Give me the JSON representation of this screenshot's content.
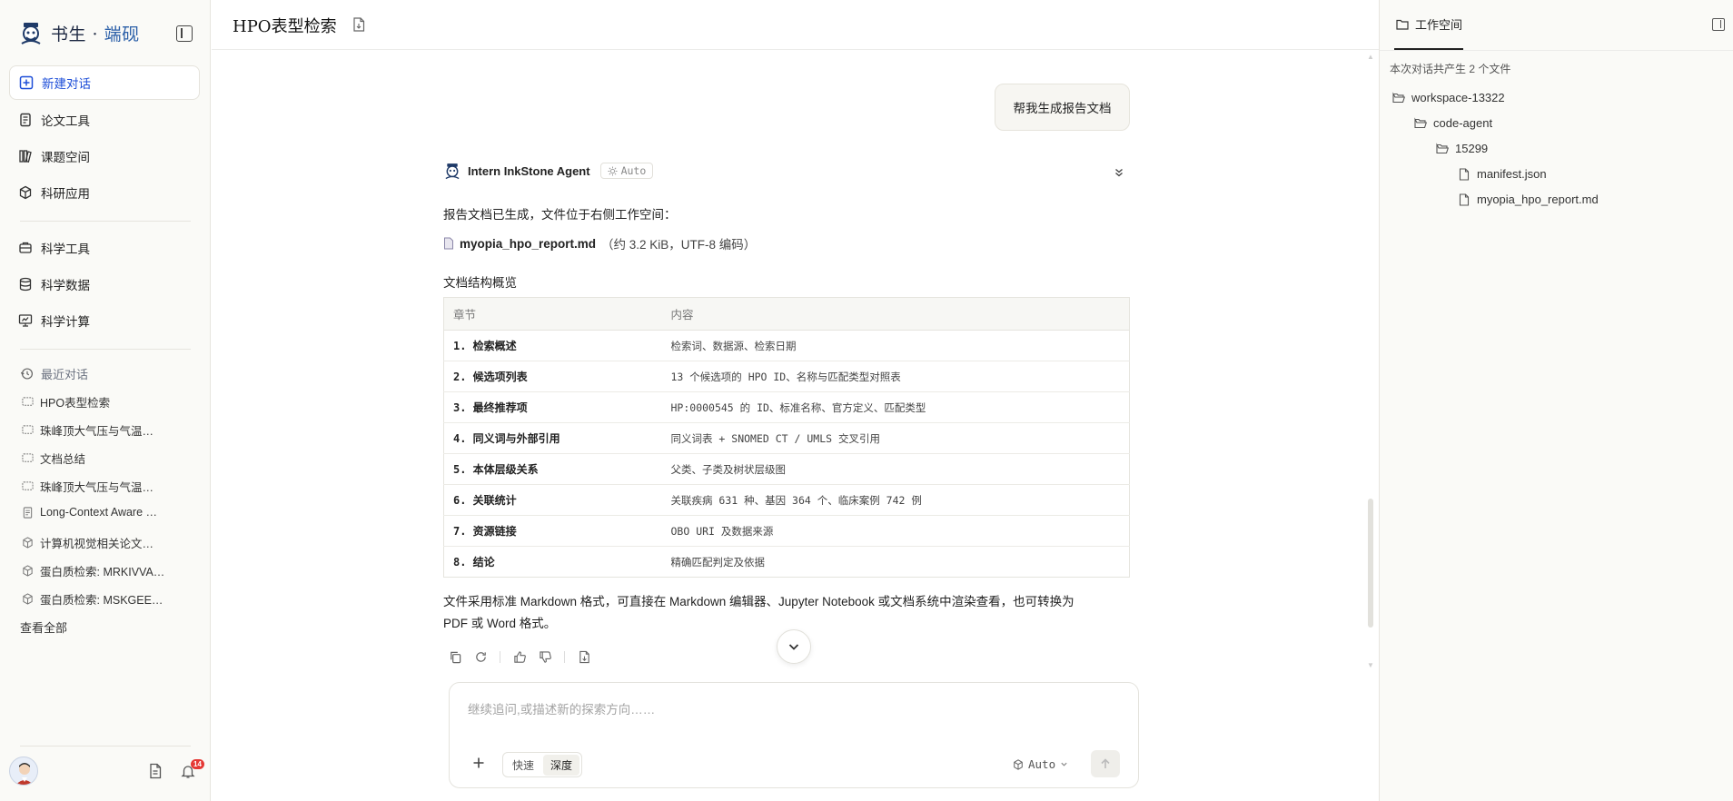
{
  "brand": {
    "name_main": "书生",
    "name_sep": " · ",
    "name_accent": "端砚"
  },
  "sidebar": {
    "new_chat": "新建对话",
    "items": [
      {
        "label": "论文工具",
        "icon": "document-icon"
      },
      {
        "label": "课题空间",
        "icon": "library-icon"
      },
      {
        "label": "科研应用",
        "icon": "cube-icon"
      },
      {
        "label": "科学工具",
        "icon": "toolbox-icon"
      },
      {
        "label": "科学数据",
        "icon": "database-icon"
      },
      {
        "label": "科学计算",
        "icon": "monitor-icon"
      }
    ],
    "recent_title": "最近对话",
    "recent": [
      {
        "label": "HPO表型检索",
        "icon": "chat-icon"
      },
      {
        "label": "珠峰顶大气压与气温…",
        "icon": "chat-icon"
      },
      {
        "label": "文档总结",
        "icon": "chat-icon"
      },
      {
        "label": "珠峰顶大气压与气温…",
        "icon": "chat-icon"
      },
      {
        "label": "Long-Context Aware …",
        "icon": "document-icon"
      },
      {
        "label": "计算机视觉相关论文…",
        "icon": "cube-icon"
      },
      {
        "label": "蛋白质检索: MRKIVVA…",
        "icon": "cube-icon"
      },
      {
        "label": "蛋白质检索: MSKGEE…",
        "icon": "cube-icon"
      }
    ],
    "view_all": "查看全部",
    "notification_count": "14"
  },
  "header": {
    "title": "HPO表型检索"
  },
  "chat": {
    "user_message": "帮我生成报告文档",
    "agent_name": "Intern InkStone Agent",
    "agent_mode": "Auto",
    "intro": "报告文档已生成，文件位于右侧工作空间：",
    "file_name": "myopia_hpo_report.md",
    "file_meta": "（约 3.2 KiB，UTF-8 编码）",
    "structure_title": "文档结构概览",
    "table": {
      "headers": [
        "章节",
        "内容"
      ],
      "rows": [
        [
          "1. 检索概述",
          "检索词、数据源、检索日期"
        ],
        [
          "2. 候选项列表",
          "13 个候选项的 HPO ID、名称与匹配类型对照表"
        ],
        [
          "3. 最终推荐项",
          "HP:0000545 的 ID、标准名称、官方定义、匹配类型"
        ],
        [
          "4. 同义词与外部引用",
          "同义词表 + SNOMED CT / UMLS 交叉引用"
        ],
        [
          "5. 本体层级关系",
          "父类、子类及树状层级图"
        ],
        [
          "6. 关联统计",
          "关联疾病 631 种、基因 364 个、临床案例 742 例"
        ],
        [
          "7. 资源链接",
          "OBO URI 及数据来源"
        ],
        [
          "8. 结论",
          "精确匹配判定及依据"
        ]
      ]
    },
    "closing_line1": "文件采用标准 Markdown 格式，可直接在 Markdown 编辑器、Jupyter Notebook 或文档系统中渲染查看，也可转换为",
    "closing_line2": "PDF 或 Word 格式。"
  },
  "composer": {
    "placeholder": "继续追问,或描述新的探索方向……",
    "speed_fast": "快速",
    "speed_deep": "深度",
    "mode": "Auto"
  },
  "workspace": {
    "tab": "工作空间",
    "summary": "本次对话共产生 2 个文件",
    "tree": [
      {
        "label": "workspace-13322",
        "type": "folder",
        "depth": 0
      },
      {
        "label": "code-agent",
        "type": "folder",
        "depth": 1
      },
      {
        "label": "15299",
        "type": "folder",
        "depth": 2
      },
      {
        "label": "manifest.json",
        "type": "file",
        "depth": 3
      },
      {
        "label": "myopia_hpo_report.md",
        "type": "file",
        "depth": 3
      }
    ]
  },
  "colors": {
    "accent": "#1d4ed8",
    "brand_accent": "#2b5fa8",
    "badge": "#e53935"
  }
}
